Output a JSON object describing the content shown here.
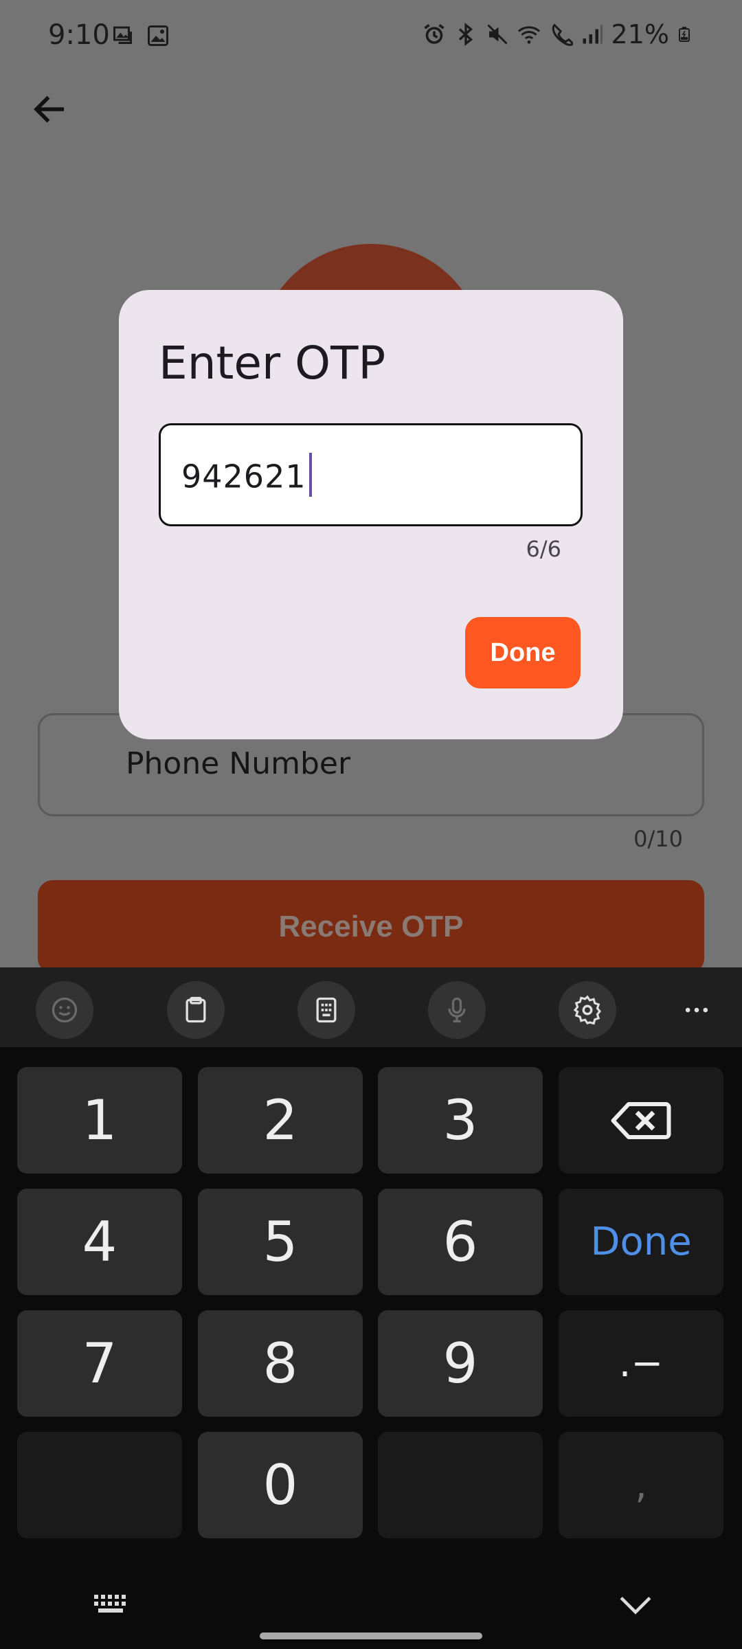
{
  "status_bar": {
    "time": "9:10",
    "battery_percent": "21%",
    "left_icons": [
      "gallery-icon",
      "image-icon"
    ],
    "right_icons": [
      "alarm-icon",
      "bluetooth-icon",
      "mute-icon",
      "wifi-icon",
      "wifi-calling-icon",
      "signal-icon",
      "battery-charging-icon"
    ]
  },
  "app": {
    "phone_field": {
      "label": "Phone Number",
      "counter": "0/10"
    },
    "receive_button": {
      "label": "Receive OTP"
    },
    "colors": {
      "primary_button": "#7a2b12",
      "avatar": "#7a311d"
    }
  },
  "dialog": {
    "title": "Enter OTP",
    "otp_value": "942621",
    "counter": "6/6",
    "done_label": "Done",
    "colors": {
      "background": "#ece5ed",
      "done_button": "#fe5722",
      "caret": "#6750a4"
    }
  },
  "keyboard": {
    "toolbar": [
      "emoji-icon",
      "clipboard-icon",
      "keypad-icon",
      "microphone-icon",
      "settings-icon",
      "more-icon"
    ],
    "keys": {
      "k1": "1",
      "k2": "2",
      "k3": "3",
      "k4": "4",
      "k5": "5",
      "k6": "6",
      "k7": "7",
      "k8": "8",
      "k9": "9",
      "k0": "0",
      "done": "Done",
      "punct": ".−",
      "comma": ","
    },
    "colors": {
      "done_key": "#4f8fe6"
    }
  }
}
